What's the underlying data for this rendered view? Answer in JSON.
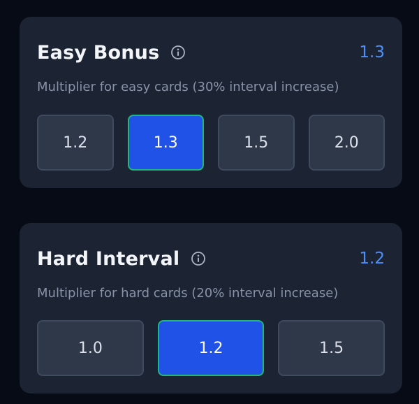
{
  "easy_bonus": {
    "title": "Easy Bonus",
    "value": "1.3",
    "description": "Multiplier for easy cards (30% interval increase)",
    "options": [
      "1.2",
      "1.3",
      "1.5",
      "2.0"
    ],
    "selected": "1.3",
    "info_icon": "info-icon"
  },
  "hard_interval": {
    "title": "Hard Interval",
    "value": "1.2",
    "description": "Multiplier for hard cards (20% interval increase)",
    "options": [
      "1.0",
      "1.2",
      "1.5"
    ],
    "selected": "1.2",
    "info_icon": "info-icon"
  },
  "colors": {
    "background": "#070b16",
    "card": "#1c2433",
    "accent_value": "#4f8ff7",
    "selected_fill": "#2152e8",
    "selected_border": "#1fb67f",
    "option_fill": "#2e3849"
  }
}
